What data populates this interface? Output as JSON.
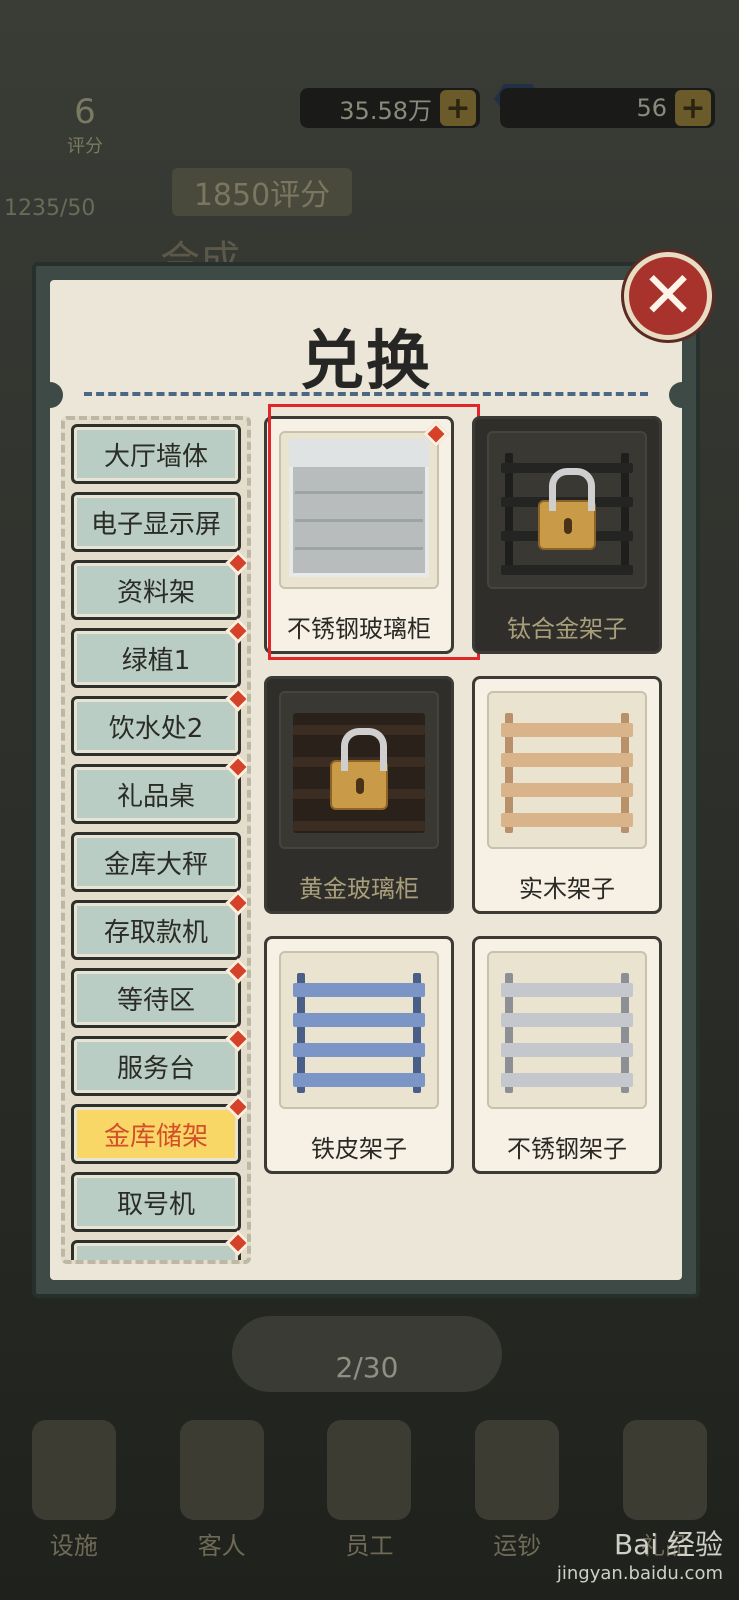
{
  "hud": {
    "coins": "35.58万",
    "gems": "56",
    "rating_number": "6",
    "rating_label": "评分",
    "rating_badge": "1850评分",
    "score_fraction": "1235/50",
    "bg_tab_title": "合成",
    "page_counter": "2/30"
  },
  "bottom_nav": [
    {
      "label": "设施"
    },
    {
      "label": "客人"
    },
    {
      "label": "员工"
    },
    {
      "label": "运钞"
    },
    {
      "label": "礼品"
    }
  ],
  "modal": {
    "title": "兑换",
    "close_symbol": "✕"
  },
  "categories": [
    {
      "label": "大厅墙体",
      "badge": false,
      "active": false
    },
    {
      "label": "电子显示屏",
      "badge": false,
      "active": false
    },
    {
      "label": "资料架",
      "badge": true,
      "active": false
    },
    {
      "label": "绿植1",
      "badge": true,
      "active": false
    },
    {
      "label": "饮水处2",
      "badge": true,
      "active": false
    },
    {
      "label": "礼品桌",
      "badge": true,
      "active": false
    },
    {
      "label": "金库大秤",
      "badge": false,
      "active": false
    },
    {
      "label": "存取款机",
      "badge": true,
      "active": false
    },
    {
      "label": "等待区",
      "badge": true,
      "active": false
    },
    {
      "label": "服务台",
      "badge": true,
      "active": false
    },
    {
      "label": "金库储架",
      "badge": true,
      "active": true
    },
    {
      "label": "取号机",
      "badge": false,
      "active": false
    },
    {
      "label": "",
      "badge": true,
      "active": false
    }
  ],
  "items": [
    {
      "label": "不锈钢玻璃柜",
      "locked": false,
      "badge": true,
      "style": "glass",
      "highlighted": true
    },
    {
      "label": "钛合金架子",
      "locked": true,
      "badge": false,
      "style": "dark-rack",
      "highlighted": false
    },
    {
      "label": "黄金玻璃柜",
      "locked": true,
      "badge": false,
      "style": "brown-cabinet",
      "highlighted": false
    },
    {
      "label": "实木架子",
      "locked": false,
      "badge": false,
      "style": "wood-rack",
      "highlighted": false
    },
    {
      "label": "铁皮架子",
      "locked": false,
      "badge": false,
      "style": "blue-rack",
      "highlighted": false
    },
    {
      "label": "不锈钢架子",
      "locked": false,
      "badge": false,
      "style": "steel-rack",
      "highlighted": false
    }
  ],
  "colors": {
    "highlight": "#e0262a",
    "badge": "#d6412a",
    "active_category_bg": "#f8d766",
    "active_category_text": "#d24f2a",
    "close_button": "#a8332c"
  },
  "watermark": {
    "brand": "Bai 经验",
    "url": "jingyan.baidu.com"
  }
}
